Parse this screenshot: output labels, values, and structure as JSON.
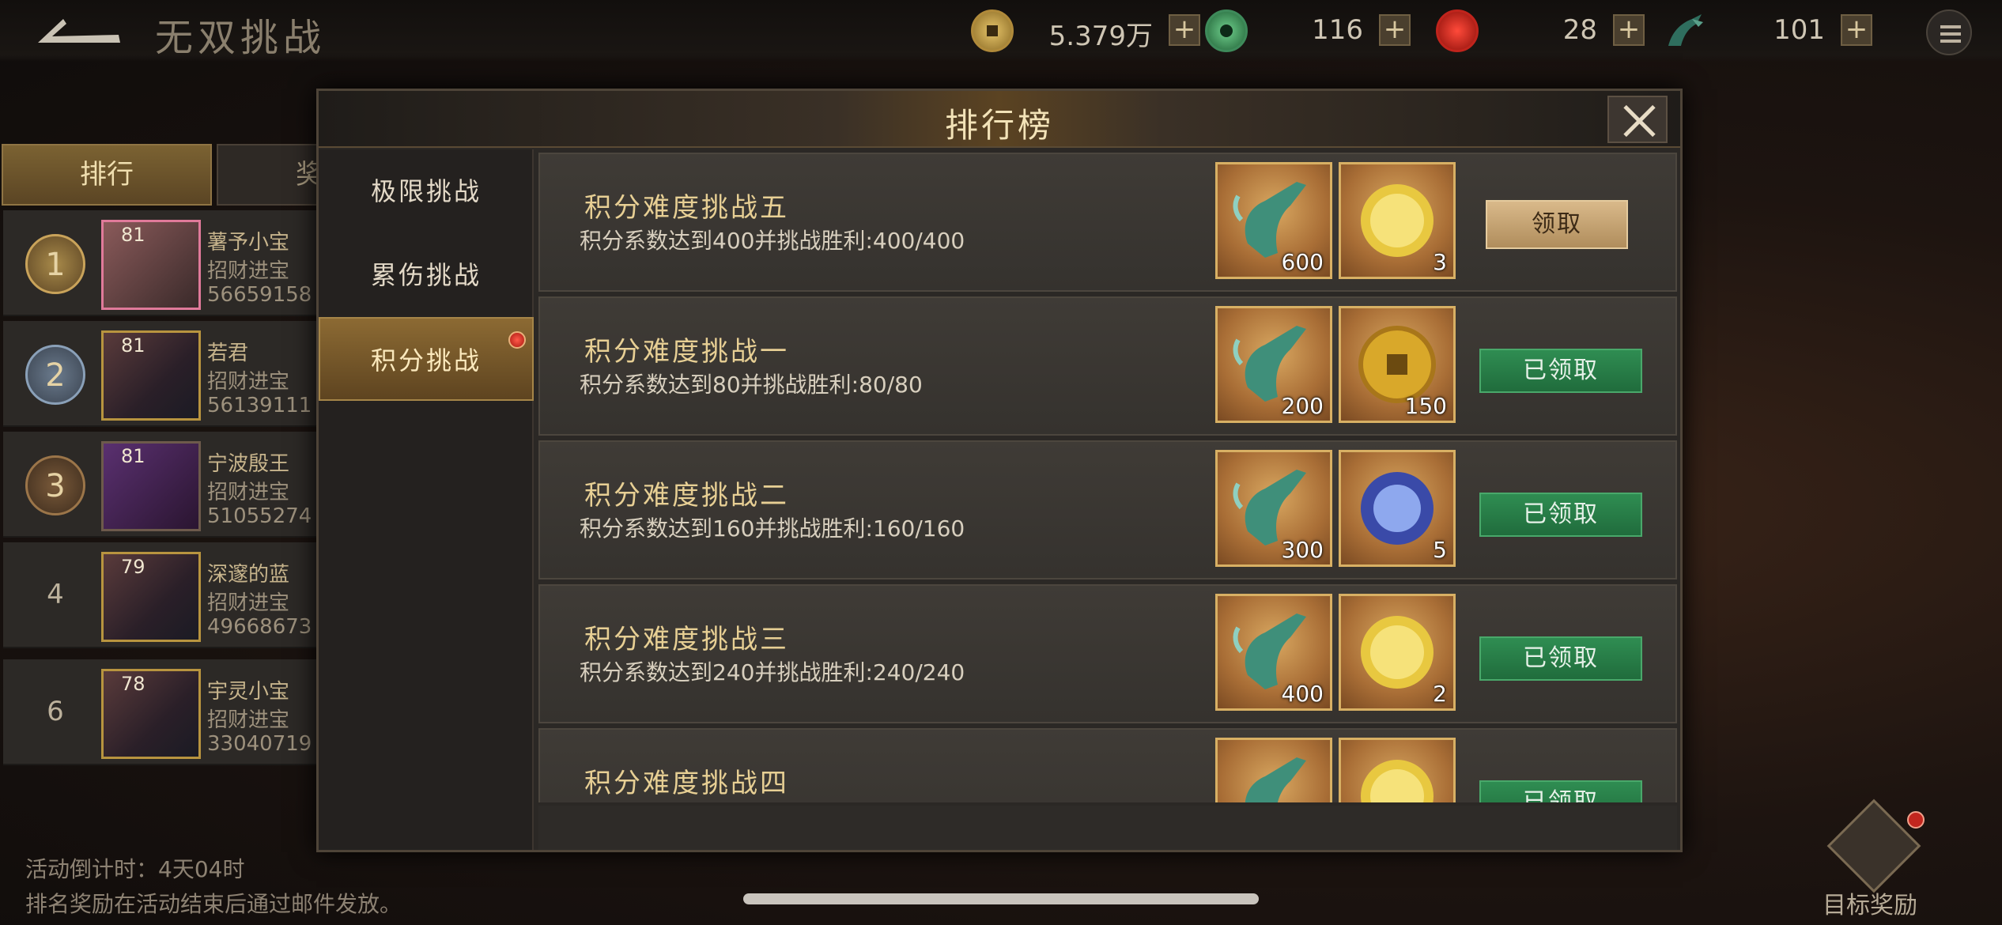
{
  "header": {
    "title": "无双挑战",
    "back_icon": "back-arrow-icon",
    "menu_icon": "list-menu-icon"
  },
  "resources": [
    {
      "name": "copper-coin",
      "icon": "coin-icon",
      "value": "5.379万",
      "color": "#b08a3a"
    },
    {
      "name": "jade",
      "icon": "jade-icon",
      "value": "116",
      "color": "#3e8a5a"
    },
    {
      "name": "red-gem",
      "icon": "red-gem-icon",
      "value": "28",
      "color": "#c0241c"
    },
    {
      "name": "dragon-token",
      "icon": "dragon-icon",
      "value": "101",
      "color": "#2f6e5e"
    }
  ],
  "left_panel": {
    "tab_rank": "排行",
    "tab_reward": "奖",
    "rows": [
      {
        "rank": "1",
        "level": "81",
        "name": "薯予小宝",
        "sub": "招财进宝",
        "score": "56659158"
      },
      {
        "rank": "2",
        "level": "81",
        "name": "若君",
        "sub": "招财进宝",
        "score": "56139111"
      },
      {
        "rank": "3",
        "level": "81",
        "name": "宁波殷王",
        "sub": "招财进宝",
        "score": "51055274"
      },
      {
        "rank": "4",
        "level": "79",
        "name": "深邃的蓝",
        "sub": "招财进宝",
        "score": "49668673"
      },
      {
        "rank": "6",
        "level": "78",
        "name": "宇灵小宝",
        "sub": "招财进宝",
        "score": "33040719"
      }
    ],
    "countdown": "活动倒计时：4天04时",
    "mail_note": "排名奖励在活动结束后通过邮件发放。"
  },
  "target_reward": {
    "label": "目标奖励",
    "icon": "treasure-chest-icon"
  },
  "modal": {
    "title": "排行榜",
    "close_icon": "close-icon",
    "nav": [
      "极限挑战",
      "累伤挑战",
      "积分挑战"
    ],
    "cards": [
      {
        "title": "积分难度挑战五",
        "desc": "积分系数达到400并挑战胜利:400/400",
        "items": [
          {
            "type": "sword",
            "qty": "600"
          },
          {
            "type": "gold-orb",
            "qty": "3"
          }
        ],
        "button": "领取",
        "state": "claimable"
      },
      {
        "title": "积分难度挑战一",
        "desc": "积分系数达到80并挑战胜利:80/80",
        "items": [
          {
            "type": "sword",
            "qty": "200"
          },
          {
            "type": "coin",
            "qty": "150"
          }
        ],
        "button": "已领取",
        "state": "claimed"
      },
      {
        "title": "积分难度挑战二",
        "desc": "积分系数达到160并挑战胜利:160/160",
        "items": [
          {
            "type": "sword",
            "qty": "300"
          },
          {
            "type": "blue-orb",
            "qty": "5"
          }
        ],
        "button": "已领取",
        "state": "claimed"
      },
      {
        "title": "积分难度挑战三",
        "desc": "积分系数达到240并挑战胜利:240/240",
        "items": [
          {
            "type": "sword",
            "qty": "400"
          },
          {
            "type": "gold-orb",
            "qty": "2"
          }
        ],
        "button": "已领取",
        "state": "claimed"
      },
      {
        "title": "积分难度挑战四",
        "desc": "",
        "items": [
          {
            "type": "sword",
            "qty": ""
          },
          {
            "type": "gold-orb",
            "qty": ""
          }
        ],
        "button": "已领取",
        "state": "claimed"
      }
    ]
  }
}
